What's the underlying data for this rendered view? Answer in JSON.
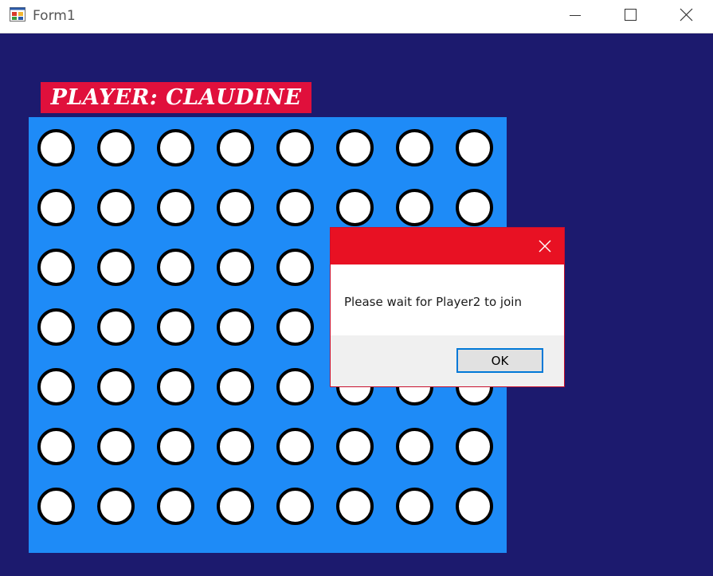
{
  "window": {
    "title": "Form1",
    "icon": "winforms-app-icon",
    "controls": [
      "minimize-icon",
      "maximize-icon",
      "close-icon"
    ]
  },
  "player": {
    "label": "PLAYER: CLAUDINE"
  },
  "board": {
    "rows": 7,
    "columns": 8,
    "background_color": "#1e8bf7",
    "hole_color": "#ffffff"
  },
  "dialog": {
    "message": "Please wait for Player2 to join",
    "ok_label": "OK",
    "title_bar_color": "#e81123"
  },
  "colors": {
    "client_background": "#1c1a6e",
    "player_label_background": "#e0103c"
  }
}
